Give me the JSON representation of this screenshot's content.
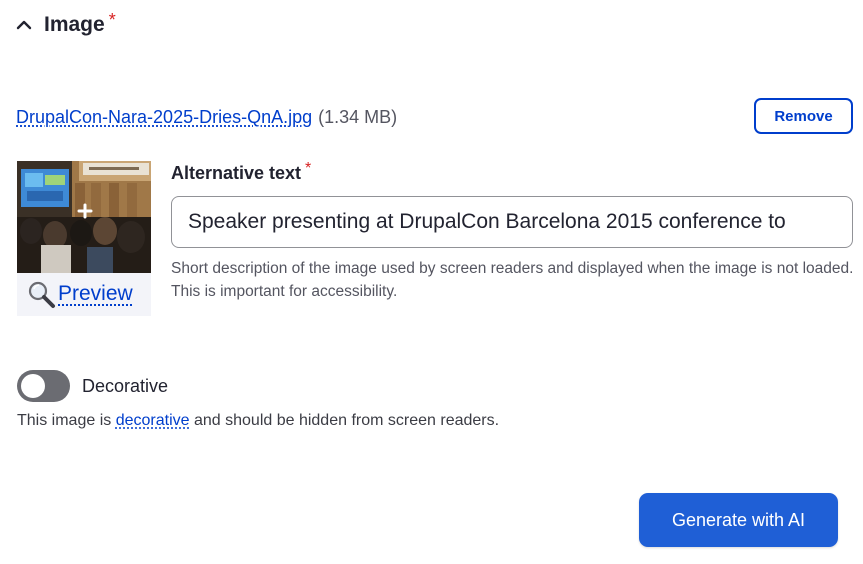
{
  "section": {
    "title": "Image",
    "required_mark": "*",
    "toggle_icon": "chevron-up-icon"
  },
  "file": {
    "name": "DrupalCon-Nara-2025-Dries-QnA.jpg",
    "size": "(1.34 MB)",
    "remove_label": "Remove"
  },
  "thumbnail": {
    "preview_label": "Preview",
    "preview_icon": "magnifier-icon"
  },
  "alt_text": {
    "label": "Alternative text",
    "required_mark": "*",
    "value": "Speaker presenting at DrupalCon Barcelona 2015 conference to",
    "description": "Short description of the image used by screen readers and displayed when the image is not loaded. This is important for accessibility."
  },
  "decorative": {
    "label": "Decorative",
    "enabled": false,
    "help_before": "This image is ",
    "help_link": "decorative",
    "help_after": " and should be hidden from screen readers."
  },
  "actions": {
    "generate_label": "Generate with AI"
  },
  "colors": {
    "link": "#003ecc",
    "required": "#d72222",
    "primary_button": "#1f5fd6",
    "toggle_off": "#6b6c72"
  }
}
